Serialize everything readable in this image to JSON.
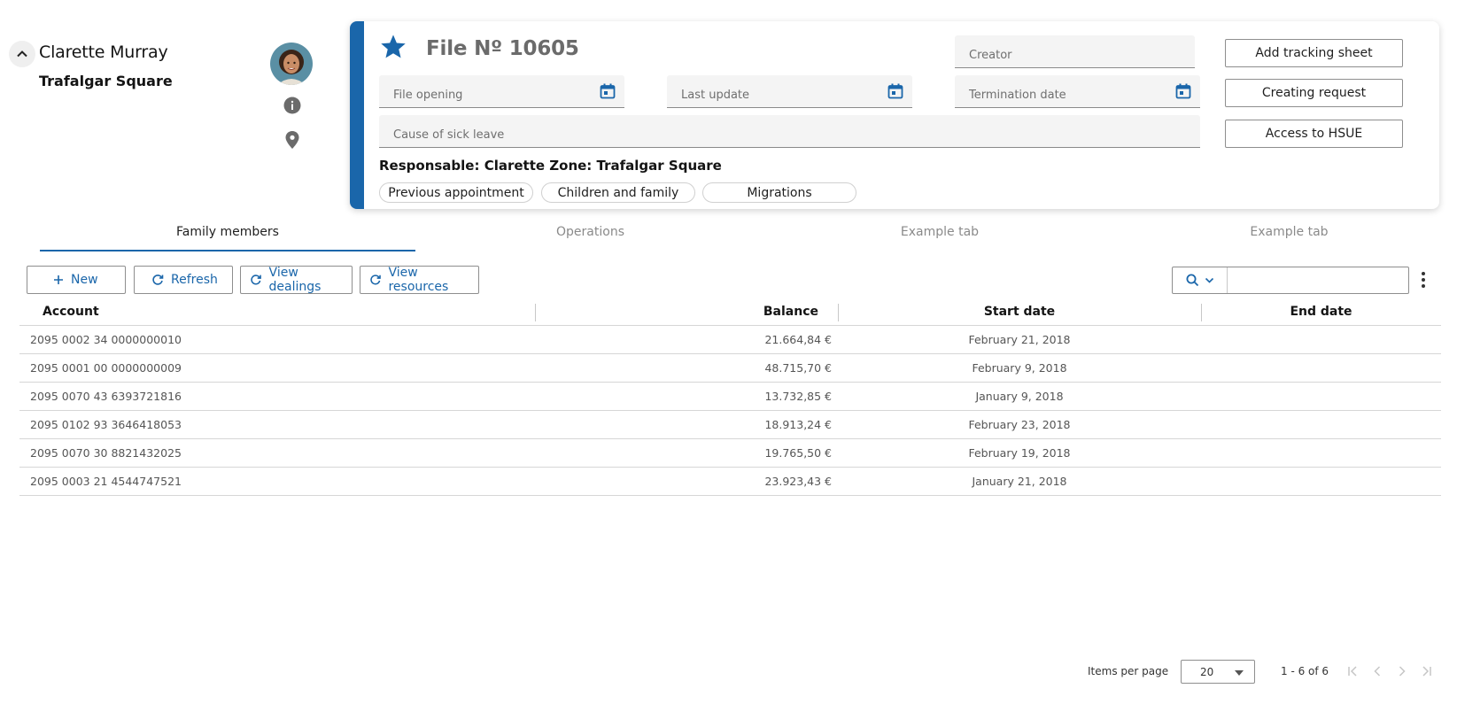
{
  "colors": {
    "accent": "#1a66aa",
    "icon_gray": "#6b6b6b"
  },
  "profile": {
    "name": "Clarette Murray",
    "zone": "Trafalgar Square",
    "icons": [
      "chevron-up-icon",
      "info-icon",
      "location-pin-icon"
    ]
  },
  "file": {
    "title": "File Nº 10605",
    "fields": {
      "creator": "Creator",
      "file_opening": "File opening",
      "last_update": "Last update",
      "termination_date": "Termination date",
      "cause": "Cause of sick leave"
    },
    "responsable_line": "Responsable: Clarette  Zone: Trafalgar Square",
    "chips": [
      "Previous appointment",
      "Children and family",
      "Migrations"
    ],
    "actions": [
      "Add tracking sheet",
      "Creating request",
      "Access to HSUE"
    ]
  },
  "tabs": [
    "Family members",
    "Operations",
    "Example tab",
    "Example tab"
  ],
  "toolbar": {
    "new": "New",
    "refresh": "Refresh",
    "view_dealings": "View dealings",
    "view_resources": "View resources",
    "search_value": ""
  },
  "table": {
    "headers": [
      "Account",
      "Balance",
      "Start date",
      "End date"
    ],
    "rows": [
      {
        "account": "2095 0002 34 0000000010",
        "balance": "21.664,84 €",
        "start": "February 21, 2018",
        "end": ""
      },
      {
        "account": "2095 0001 00 0000000009",
        "balance": "48.715,70 €",
        "start": "February 9, 2018",
        "end": ""
      },
      {
        "account": "2095 0070 43 6393721816",
        "balance": "13.732,85 €",
        "start": "January 9, 2018",
        "end": ""
      },
      {
        "account": "2095 0102 93 3646418053",
        "balance": "18.913,24 €",
        "start": "February 23, 2018",
        "end": ""
      },
      {
        "account": "2095 0070 30 8821432025",
        "balance": "19.765,50 €",
        "start": "February 19, 2018",
        "end": ""
      },
      {
        "account": "2095 0003 21 4544747521",
        "balance": "23.923,43 €",
        "start": "January 21, 2018",
        "end": ""
      }
    ]
  },
  "paginator": {
    "items_per_page_label": "Items per page",
    "items_per_page": "20",
    "range": "1 - 6 of 6"
  }
}
